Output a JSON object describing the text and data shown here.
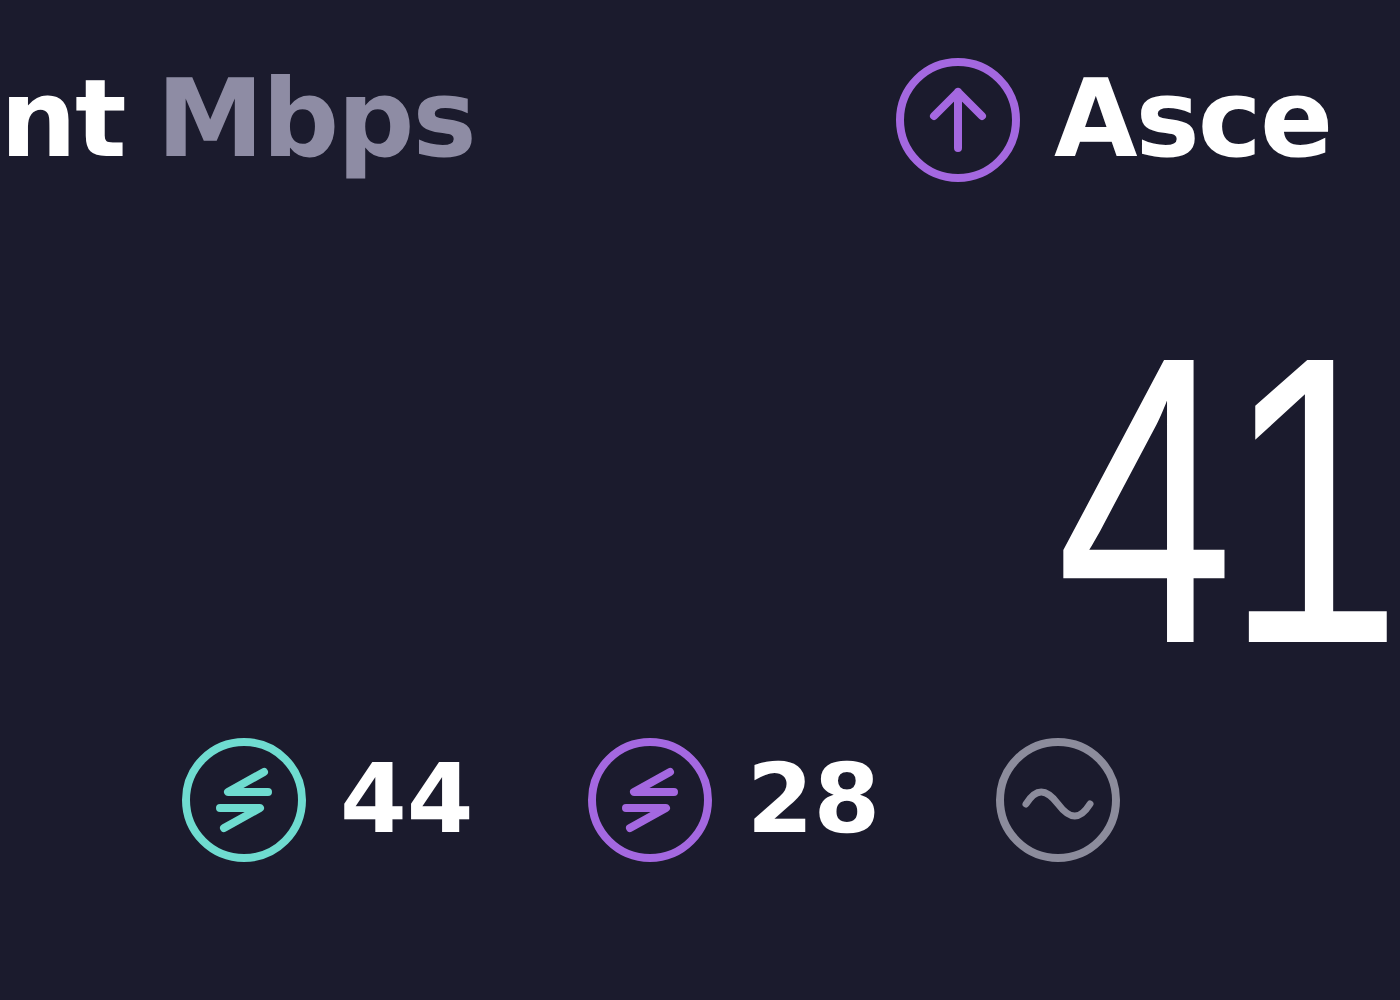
{
  "download": {
    "label": "nt",
    "unit": "Mbps"
  },
  "upload": {
    "label": "Asce",
    "value": "41"
  },
  "stats": [
    {
      "kind": "exchange",
      "color": "#6fdcd0",
      "value": "44"
    },
    {
      "kind": "exchange",
      "color": "#a468e0",
      "value": "28"
    },
    {
      "kind": "wave",
      "color": "#8c8c9c"
    }
  ]
}
